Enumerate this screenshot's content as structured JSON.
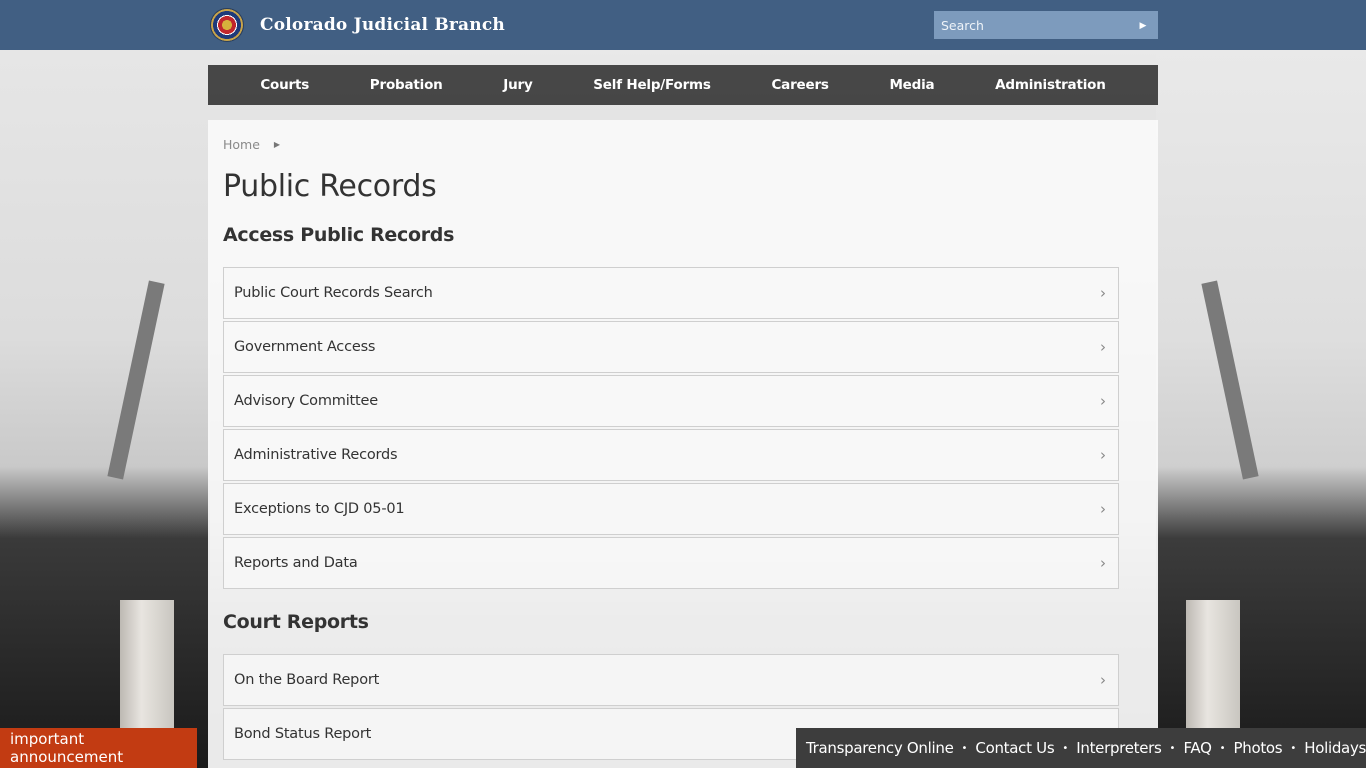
{
  "header": {
    "site_title": "Colorado Judicial Branch",
    "logo_icon": "colorado-courts-seal",
    "search": {
      "placeholder": "Search",
      "value": "",
      "button_icon": "arrow-right-icon"
    },
    "colors": {
      "header_bg": "#415f83",
      "search_bg": "#7d9bbd"
    }
  },
  "nav": {
    "items": [
      {
        "label": "Courts"
      },
      {
        "label": "Probation"
      },
      {
        "label": "Jury"
      },
      {
        "label": "Self Help/Forms"
      },
      {
        "label": "Careers"
      },
      {
        "label": "Media"
      },
      {
        "label": "Administration"
      }
    ]
  },
  "breadcrumb": {
    "items": [
      {
        "label": "Home"
      }
    ],
    "separator_icon": "caret-right-icon"
  },
  "page": {
    "title": "Public Records",
    "sections": [
      {
        "title": "Access Public Records",
        "items": [
          {
            "label": "Public Court Records Search"
          },
          {
            "label": "Government Access"
          },
          {
            "label": "Advisory Committee"
          },
          {
            "label": "Administrative Records"
          },
          {
            "label": "Exceptions to CJD 05-01"
          },
          {
            "label": "Reports and Data"
          }
        ]
      },
      {
        "title": "Court Reports",
        "items": [
          {
            "label": "On the Board Report"
          },
          {
            "label": "Bond Status Report"
          }
        ]
      }
    ],
    "item_icon": "chevron-right-icon"
  },
  "announcement": {
    "label": "important announcement",
    "color": "#c23b12"
  },
  "footer": {
    "links": [
      {
        "label": "Transparency Online"
      },
      {
        "label": "Contact Us"
      },
      {
        "label": "Interpreters"
      },
      {
        "label": "FAQ"
      },
      {
        "label": "Photos"
      },
      {
        "label": "Holidays"
      }
    ],
    "separator": "•"
  }
}
